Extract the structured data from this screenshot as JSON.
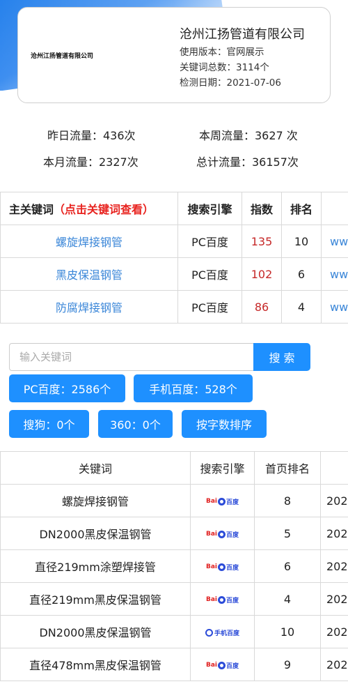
{
  "header": {
    "logo_text": "沧州江扬管道有限公司",
    "company": "沧州江扬管道有限公司",
    "version": "使用版本：官网展示",
    "keyword_total": "关键词总数：3114个",
    "check_date": "检测日期：2021-07-06"
  },
  "stats": {
    "yesterday": "昨日流量：436次",
    "week": "本周流量：3627 次",
    "month": "本月流量：2327次",
    "total": "总计流量：36157次"
  },
  "main_table": {
    "headers": {
      "keyword": "主关键词",
      "keyword_hint": "（点击关键词查看）",
      "engine": "搜索引擎",
      "index": "指数",
      "rank": "排名"
    },
    "rows": [
      {
        "keyword": "螺旋焊接钢管",
        "engine": "PC百度",
        "index": "135",
        "rank": "10",
        "url": "www"
      },
      {
        "keyword": "黑皮保温钢管",
        "engine": "PC百度",
        "index": "102",
        "rank": "6",
        "url": "www"
      },
      {
        "keyword": "防腐焊接钢管",
        "engine": "PC百度",
        "index": "86",
        "rank": "4",
        "url": "www"
      }
    ]
  },
  "search": {
    "placeholder": "输入关键词",
    "button": "搜 索"
  },
  "filters": {
    "pc_baidu": "PC百度：2586个",
    "mobile_baidu": "手机百度：528个",
    "sogou": "搜狗：0个",
    "s360": "360：0个",
    "sort": "按字数排序"
  },
  "kw_table": {
    "headers": {
      "keyword": "关键词",
      "engine": "搜索引擎",
      "rank": "首页排名"
    },
    "logos": {
      "pc_bai": "Bai",
      "pc_du": "百度",
      "mobile": "手机百度"
    },
    "rows": [
      {
        "keyword": "螺旋焊接钢管",
        "engine": "pc",
        "rank": "8",
        "date": "202"
      },
      {
        "keyword": "DN2000黑皮保温钢管",
        "engine": "pc",
        "rank": "5",
        "date": "202"
      },
      {
        "keyword": "直径219mm涂塑焊接管",
        "engine": "pc",
        "rank": "6",
        "date": "202"
      },
      {
        "keyword": "直径219mm黑皮保温钢管",
        "engine": "pc",
        "rank": "4",
        "date": "202"
      },
      {
        "keyword": "DN2000黑皮保温钢管",
        "engine": "mobile",
        "rank": "10",
        "date": "202"
      },
      {
        "keyword": "直径478mm黑皮保温钢管",
        "engine": "pc",
        "rank": "9",
        "date": "202"
      }
    ]
  },
  "colors": {
    "accent": "#1e90ff",
    "link": "#3a86d8",
    "hint_red": "#e8231f",
    "index_red": "#c62828"
  }
}
